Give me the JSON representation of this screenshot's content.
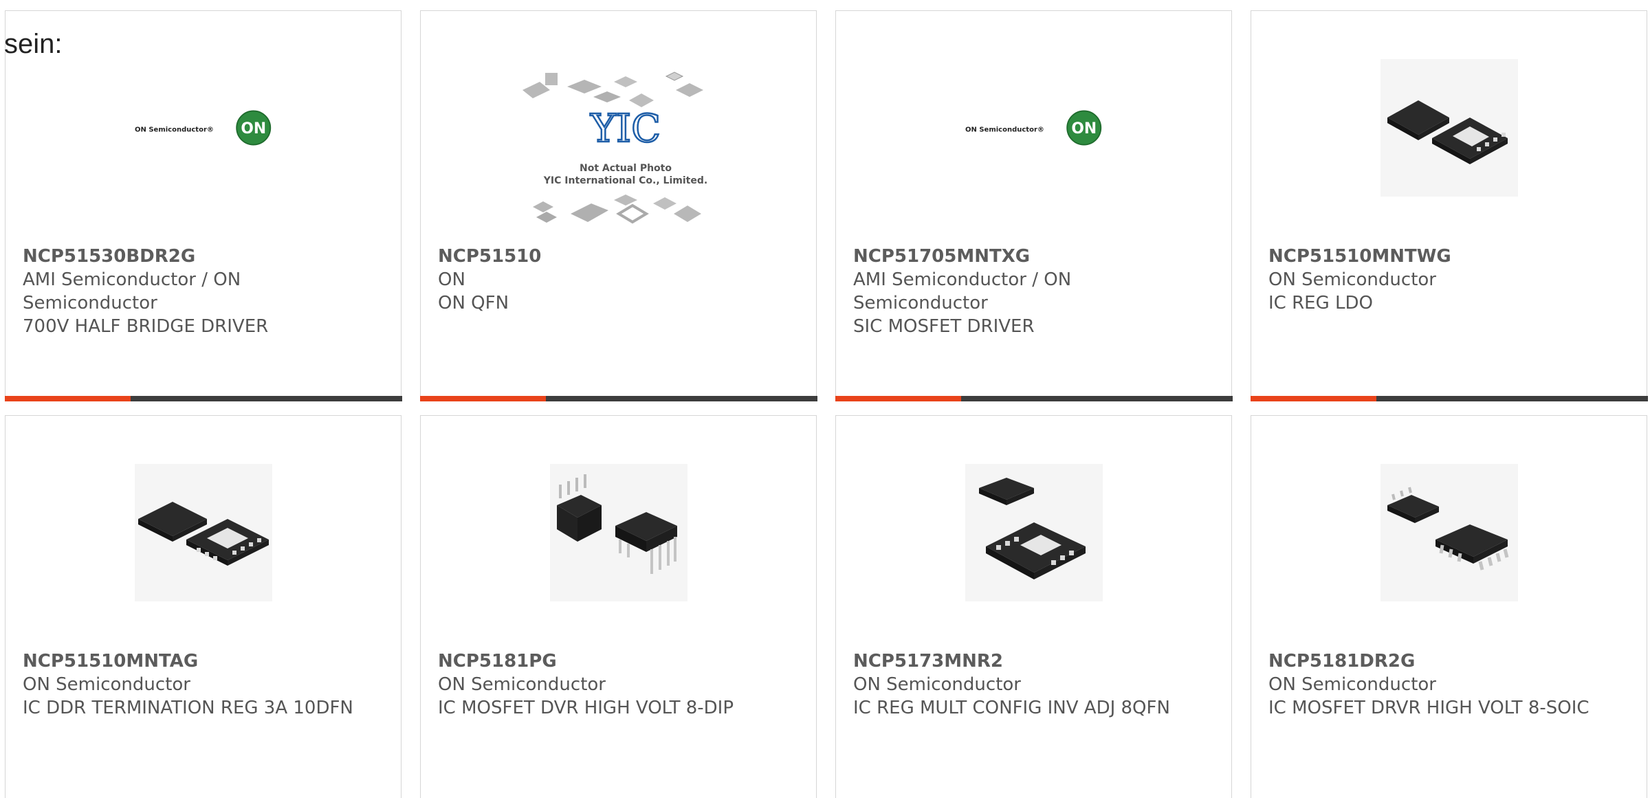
{
  "intro_text": "sein:",
  "colors": {
    "accent": "#e9431a",
    "bar": "#3d3d3d",
    "border": "#d6d6d6",
    "on_logo_green": "#2e8b3f"
  },
  "products": [
    {
      "part_number": "NCP51530BDR2G",
      "manufacturer": "AMI Semiconductor / ON Semiconductor",
      "description": "700V HALF BRIDGE DRIVER",
      "image": "on-semiconductor-logo"
    },
    {
      "part_number": "NCP51510",
      "manufacturer": "ON",
      "description": "ON QFN",
      "image": "yic-placeholder",
      "image_caption_line1": "Not Actual Photo",
      "image_caption_line2": "YIC International Co., Limited.",
      "image_logo": "YIC"
    },
    {
      "part_number": "NCP51705MNTXG",
      "manufacturer": "AMI Semiconductor / ON Semiconductor",
      "description": "SIC MOSFET DRIVER",
      "image": "on-semiconductor-logo"
    },
    {
      "part_number": "NCP51510MNTWG",
      "manufacturer": "ON Semiconductor",
      "description": "IC REG LDO",
      "image": "dfn-package-photo"
    },
    {
      "part_number": "NCP51510MNTAG",
      "manufacturer": "ON Semiconductor",
      "description": "IC DDR TERMINATION REG 3A 10DFN",
      "image": "dfn-package-photo"
    },
    {
      "part_number": "NCP5181PG",
      "manufacturer": "ON Semiconductor",
      "description": "IC MOSFET DVR HIGH VOLT 8-DIP",
      "image": "dip-package-photo"
    },
    {
      "part_number": "NCP5173MNR2",
      "manufacturer": "ON Semiconductor",
      "description": "IC REG MULT CONFIG INV ADJ 8QFN",
      "image": "qfn-package-photo"
    },
    {
      "part_number": "NCP5181DR2G",
      "manufacturer": "ON Semiconductor",
      "description": "IC MOSFET DRVR HIGH VOLT 8-SOIC",
      "image": "soic-package-photo"
    }
  ]
}
